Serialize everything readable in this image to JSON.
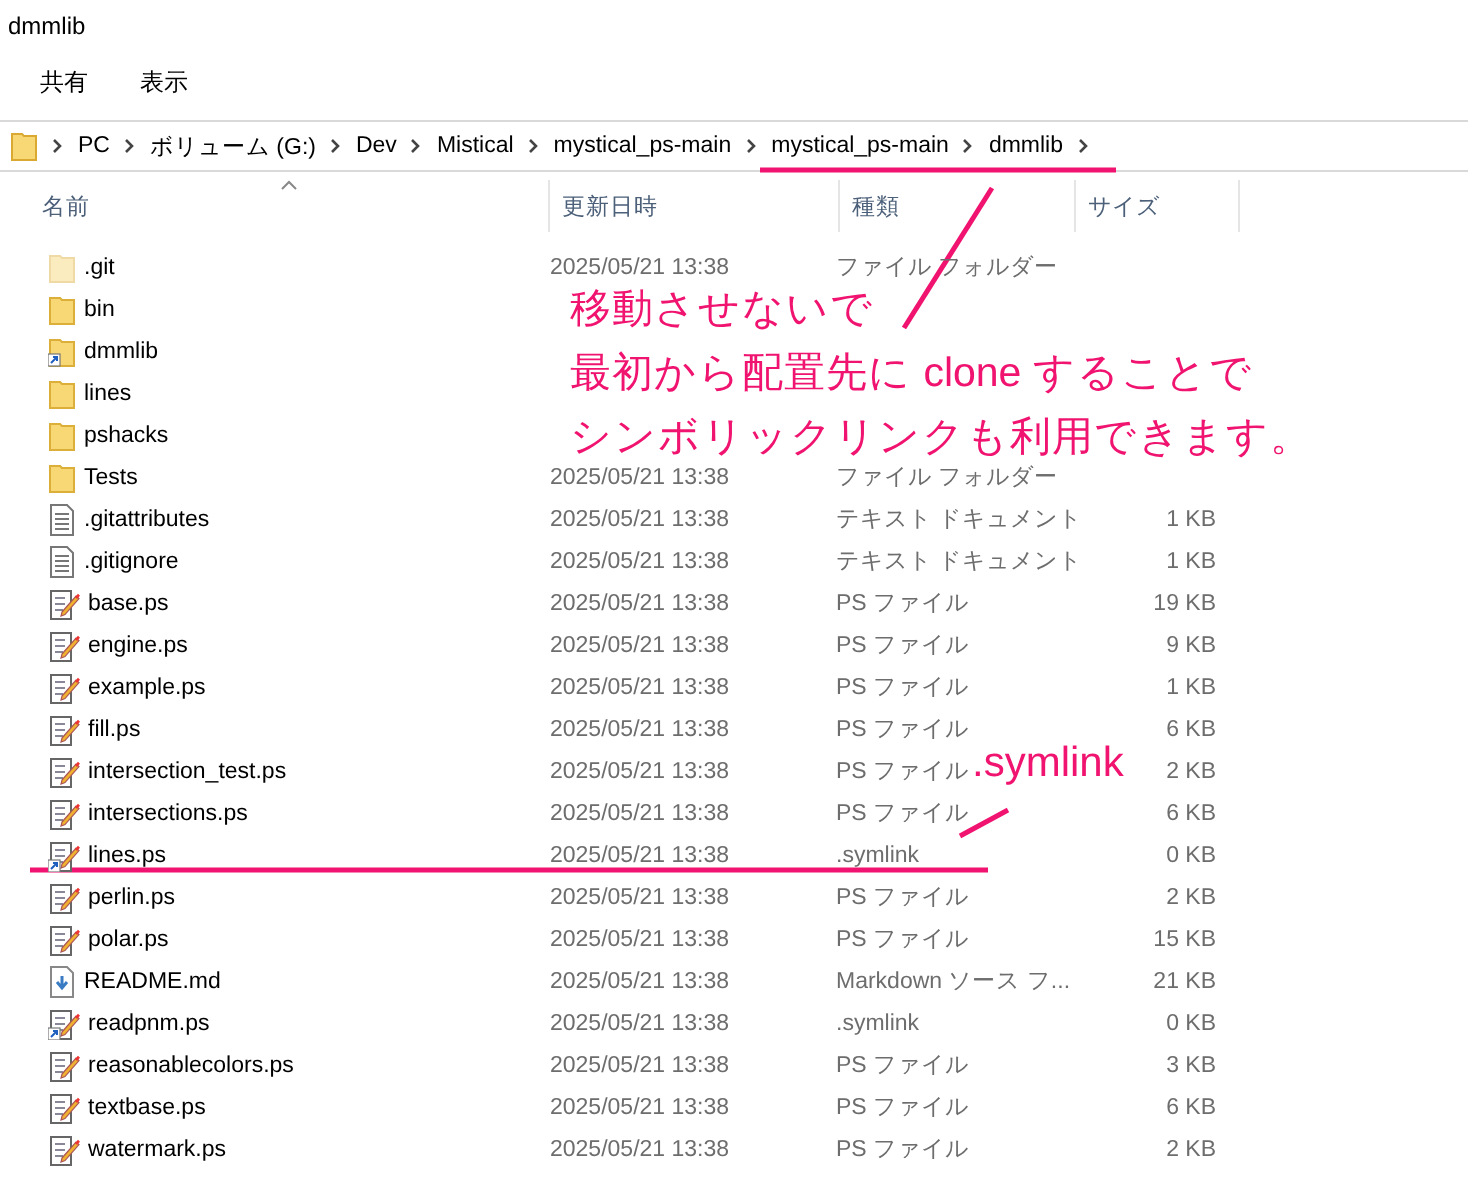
{
  "window": {
    "title": "dmmlib"
  },
  "menu": [
    "共有",
    "表示"
  ],
  "breadcrumb": [
    "PC",
    "ボリューム (G:)",
    "Dev",
    "Mistical",
    "mystical_ps-main",
    "mystical_ps-main",
    "dmmlib"
  ],
  "columns": [
    "名前",
    "更新日時",
    "種類",
    "サイズ"
  ],
  "rows": [
    {
      "kind": "hidden-folder",
      "name": ".git",
      "date": "2025/05/21 13:38",
      "type": "ファイル フォルダー"
    },
    {
      "kind": "folder",
      "name": "bin"
    },
    {
      "kind": "folder-link",
      "name": "dmmlib"
    },
    {
      "kind": "folder",
      "name": "lines"
    },
    {
      "kind": "folder",
      "name": "pshacks"
    },
    {
      "kind": "folder",
      "name": "Tests",
      "date": "2025/05/21 13:38",
      "type": "ファイル フォルダー"
    },
    {
      "kind": "text",
      "name": ".gitattributes",
      "date": "2025/05/21 13:38",
      "type": "テキスト ドキュメント",
      "size": "1 KB"
    },
    {
      "kind": "text",
      "name": ".gitignore",
      "date": "2025/05/21 13:38",
      "type": "テキスト ドキュメント",
      "size": "1 KB"
    },
    {
      "kind": "script",
      "name": "base.ps",
      "date": "2025/05/21 13:38",
      "type": "PS ファイル",
      "size": "19 KB"
    },
    {
      "kind": "script",
      "name": "engine.ps",
      "date": "2025/05/21 13:38",
      "type": "PS ファイル",
      "size": "9 KB"
    },
    {
      "kind": "script",
      "name": "example.ps",
      "date": "2025/05/21 13:38",
      "type": "PS ファイル",
      "size": "1 KB"
    },
    {
      "kind": "script",
      "name": "fill.ps",
      "date": "2025/05/21 13:38",
      "type": "PS ファイル",
      "size": "6 KB"
    },
    {
      "kind": "script",
      "name": "intersection_test.ps",
      "date": "2025/05/21 13:38",
      "type": "PS ファイル",
      "size": "2 KB"
    },
    {
      "kind": "script",
      "name": "intersections.ps",
      "date": "2025/05/21 13:38",
      "type": "PS ファイル",
      "size": "6 KB"
    },
    {
      "kind": "script-link",
      "name": "lines.ps",
      "date": "2025/05/21 13:38",
      "type": ".symlink",
      "size": "0 KB"
    },
    {
      "kind": "script",
      "name": "perlin.ps",
      "date": "2025/05/21 13:38",
      "type": "PS ファイル",
      "size": "2 KB"
    },
    {
      "kind": "script",
      "name": "polar.ps",
      "date": "2025/05/21 13:38",
      "type": "PS ファイル",
      "size": "15 KB"
    },
    {
      "kind": "markdown",
      "name": "README.md",
      "date": "2025/05/21 13:38",
      "type": "Markdown ソース フ...",
      "size": "21 KB"
    },
    {
      "kind": "script-link",
      "name": "readpnm.ps",
      "date": "2025/05/21 13:38",
      "type": ".symlink",
      "size": "0 KB"
    },
    {
      "kind": "script",
      "name": "reasonablecolors.ps",
      "date": "2025/05/21 13:38",
      "type": "PS ファイル",
      "size": "3 KB"
    },
    {
      "kind": "script",
      "name": "textbase.ps",
      "date": "2025/05/21 13:38",
      "type": "PS ファイル",
      "size": "6 KB"
    },
    {
      "kind": "script",
      "name": "watermark.ps",
      "date": "2025/05/21 13:38",
      "type": "PS ファイル",
      "size": "2 KB"
    }
  ],
  "annotations": {
    "callout": [
      "移動させないで",
      "最初から配置先に clone することで",
      "シンボリックリンクも利用できます。"
    ],
    "symlink_label": ".symlink"
  }
}
